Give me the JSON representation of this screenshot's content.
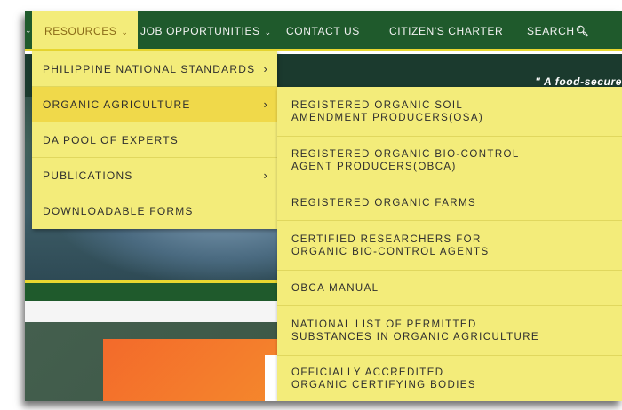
{
  "navbar": {
    "items": [
      {
        "label": "RESOURCES",
        "has_caret": true,
        "active": true
      },
      {
        "label": "JOB OPPORTUNITIES",
        "has_caret": true
      },
      {
        "label": "CONTACT US"
      },
      {
        "label": "CITIZEN'S CHARTER"
      },
      {
        "label": "SEARCH",
        "icon": "search-icon"
      }
    ]
  },
  "hero": {
    "quote": "\" A food-secure"
  },
  "resources_menu": {
    "items": [
      {
        "label": "PHILIPPINE NATIONAL STANDARDS",
        "has_submenu": true
      },
      {
        "label": "ORGANIC AGRICULTURE",
        "has_submenu": true,
        "highlighted": true
      },
      {
        "label": "DA POOL OF EXPERTS"
      },
      {
        "label": "PUBLICATIONS",
        "has_submenu": true
      },
      {
        "label": "DOWNLOADABLE FORMS"
      }
    ]
  },
  "organic_submenu": {
    "items": [
      {
        "line1": "REGISTERED ORGANIC SOIL",
        "line2": "AMENDMENT PRODUCERS(OSA)"
      },
      {
        "line1": "REGISTERED ORGANIC BIO-CONTROL",
        "line2": "AGENT PRODUCERS(OBCA)"
      },
      {
        "line1": "REGISTERED ORGANIC FARMS",
        "line2": ""
      },
      {
        "line1": "CERTIFIED RESEARCHERS FOR",
        "line2": "ORGANIC BIO-CONTROL AGENTS"
      },
      {
        "line1": "OBCA MANUAL",
        "line2": ""
      },
      {
        "line1": "NATIONAL LIST OF PERMITTED",
        "line2": "SUBSTANCES IN ORGANIC AGRICULTURE"
      },
      {
        "line1": "OFFICIALLY ACCREDITED",
        "line2": "ORGANIC CERTIFYING BODIES"
      }
    ]
  },
  "colors": {
    "nav_green": "#1f5a2c",
    "menu_yellow": "#f3ec7a",
    "hover_yellow": "#f0d94a",
    "accent_gold": "#e8d730"
  }
}
